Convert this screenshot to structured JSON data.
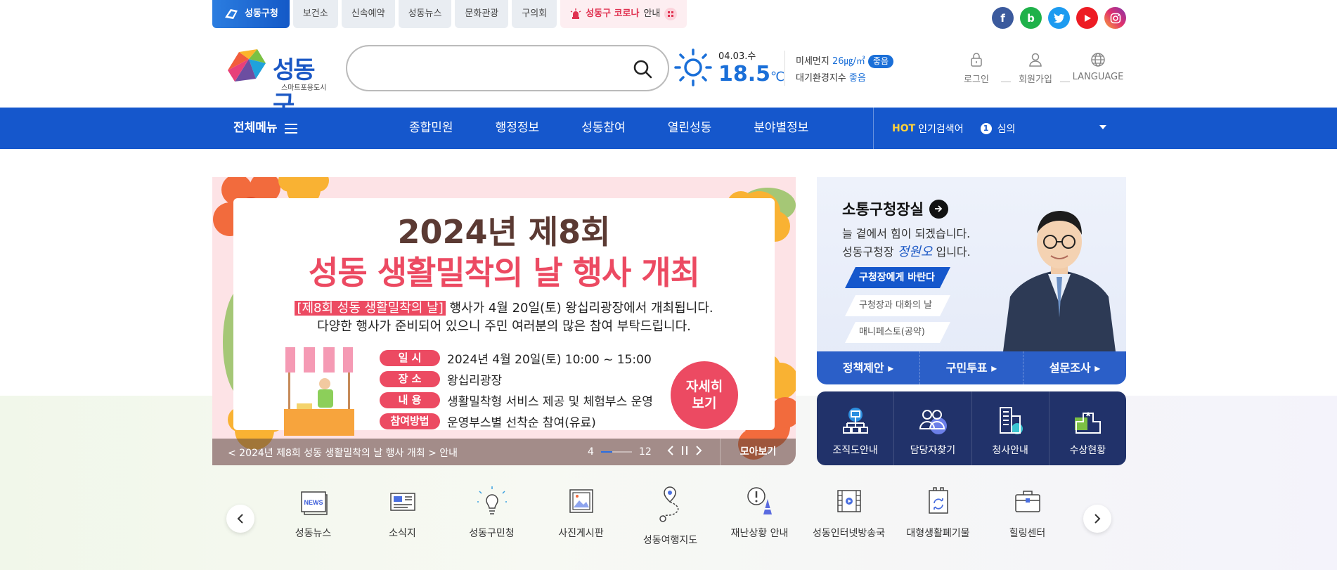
{
  "top_tabs": [
    {
      "label": "성동구청"
    },
    {
      "label": "보건소"
    },
    {
      "label": "신속예약"
    },
    {
      "label": "성동뉴스"
    },
    {
      "label": "문화관광"
    },
    {
      "label": "구의회"
    }
  ],
  "corona_tab": {
    "bold": "성동구 코로나",
    "rest": "안내"
  },
  "sns": [
    "f",
    "b"
  ],
  "logo": {
    "name": "성동구",
    "sub": "스마트포용도시"
  },
  "search": {
    "value": "",
    "placeholder": ""
  },
  "weather": {
    "date": "04.03.수",
    "temp": "18.5",
    "unit": "℃"
  },
  "air": {
    "dust_label": "미세먼지",
    "dust_value": "26㎍/㎥",
    "dust_badge": "좋음",
    "index_label": "대기환경지수",
    "index_value": "좋음"
  },
  "util": {
    "login": "로그인",
    "join": "회원가입",
    "language": "LANGUAGE"
  },
  "nav": {
    "all_menu": "전체메뉴",
    "items": [
      "종합민원",
      "행정정보",
      "성동참여",
      "열린성동",
      "분야별정보"
    ],
    "hot_label": "HOT",
    "hot_text": "인기검색어",
    "hot_rank": "1",
    "hot_keyword": "심의"
  },
  "banner": {
    "title1": "2024년 제8회",
    "title2": "성동 생활밀착의 날 행사 개최",
    "line1_highlight": "[제8회 성동 생활밀착의 날]",
    "line1_rest": "행사가 4월 20일(토) 왕십리광장에서 개최됩니다.",
    "line2": "다양한 행사가 준비되어 있으니 주민 여러분의 많은 참여 부탁드립니다.",
    "rows": [
      {
        "label": "일   시",
        "value": "2024년 4월 20일(토) 10:00 ~ 15:00"
      },
      {
        "label": "장   소",
        "value": "왕십리광장"
      },
      {
        "label": "내   용",
        "value": "생활밀착형 서비스 제공 및 체험부스 운영"
      },
      {
        "label": "참여방법",
        "value": "운영부스별 선착순 참여(유료)"
      }
    ],
    "detail_btn": "자세히 보기",
    "caption": "< 2024년 제8회 성동 생활밀착의 날 행사 개최 > 안내",
    "current": "4",
    "total": "12",
    "more": "모아보기"
  },
  "mayor": {
    "title": "소통구청장실",
    "line1": "늘 곁에서 힘이 되겠습니다.",
    "line2_pre": "성동구청장",
    "line2_post": "입니다.",
    "btn1": "구청장에게 바란다",
    "btn2": "구청장과 대화의 날",
    "btn3": "매니페스토(공약)",
    "bar": [
      "정책제안",
      "구민투표",
      "설문조사"
    ]
  },
  "quick": [
    {
      "label": "조직도안내",
      "icon": "org-chart-icon"
    },
    {
      "label": "담당자찾기",
      "icon": "people-icon"
    },
    {
      "label": "청사안내",
      "icon": "building-icon"
    },
    {
      "label": "수상현황",
      "icon": "award-icon"
    }
  ],
  "icon_row": [
    {
      "label": "성동뉴스",
      "icon": "news-icon",
      "tag": "NEWS"
    },
    {
      "label": "소식지",
      "icon": "newsletter-icon"
    },
    {
      "label": "성동구민청",
      "icon": "bulb-icon"
    },
    {
      "label": "사진게시판",
      "icon": "photo-icon"
    },
    {
      "label": "성동여행지도",
      "icon": "map-icon"
    },
    {
      "label": "재난상황 안내",
      "icon": "alert-icon"
    },
    {
      "label": "성동인터넷방송국",
      "icon": "video-icon"
    },
    {
      "label": "대형생활폐기물",
      "icon": "recycle-icon"
    },
    {
      "label": "힐링센터",
      "icon": "case-icon"
    }
  ]
}
